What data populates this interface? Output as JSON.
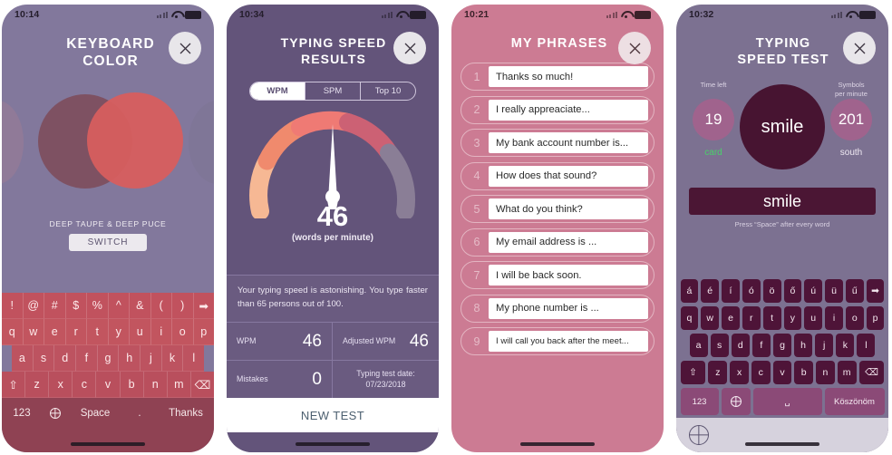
{
  "phones": [
    {
      "status": {
        "time": "10:14",
        "wifi_icon": "wifi-icon",
        "battery_icon": "battery-icon"
      },
      "title": "KEYBOARD\nCOLOR",
      "close_label": "close-icon",
      "palette_name": "DEEP TAUPE & DEEP PUCE",
      "switch_label": "SWITCH",
      "colors": {
        "swatch_a": "#7e4e5d",
        "swatch_b": "#d85e5e",
        "background": "#82789c",
        "keyboard": "#c2525f"
      },
      "keyboard": {
        "row1": [
          "!",
          "@",
          "#",
          "$",
          "%",
          "^",
          "&",
          "(",
          ")",
          "➡"
        ],
        "row2": [
          "q",
          "w",
          "e",
          "r",
          "t",
          "y",
          "u",
          "i",
          "o",
          "p"
        ],
        "row3": [
          "a",
          "s",
          "d",
          "f",
          "g",
          "h",
          "j",
          "k",
          "l"
        ],
        "row4": [
          "⇧",
          "z",
          "x",
          "c",
          "v",
          "b",
          "n",
          "m",
          "⌫"
        ],
        "bottom": {
          "numeric": "123",
          "globe": "globe-icon",
          "space": "Space",
          "period": ".",
          "suggestion": "Thanks"
        }
      }
    },
    {
      "status": {
        "time": "10:34",
        "wifi_icon": "wifi-icon",
        "battery_icon": "battery-icon"
      },
      "title": "TYPING SPEED\nRESULTS",
      "close_label": "close-icon",
      "segments": [
        {
          "label": "WPM",
          "active": true
        },
        {
          "label": "SPM",
          "active": false
        },
        {
          "label": "Top 10",
          "active": false
        }
      ],
      "gauge_value": "46",
      "gauge_unit": "(words per minute)",
      "message": "Your typing speed is astonishing. You type faster than 65 persons out of 100.",
      "stats": [
        {
          "label": "WPM",
          "value": "46"
        },
        {
          "label": "Adjusted WPM",
          "value": "46"
        },
        {
          "label": "Mistakes",
          "value": "0"
        },
        {
          "label": "Typing test date:\n07/23/2018",
          "value": ""
        }
      ],
      "new_test_label": "NEW TEST"
    },
    {
      "status": {
        "time": "10:21",
        "wifi_icon": "wifi-icon",
        "battery_icon": "battery-icon"
      },
      "title": "MY PHRASES",
      "close_label": "close-icon",
      "phrases": [
        {
          "num": "1",
          "text": "Thanks so much!"
        },
        {
          "num": "2",
          "text": "I really appreaciate..."
        },
        {
          "num": "3",
          "text": "My bank account number is..."
        },
        {
          "num": "4",
          "text": "How does that sound?"
        },
        {
          "num": "5",
          "text": "What do you think?"
        },
        {
          "num": "6",
          "text": "My email address is ..."
        },
        {
          "num": "7",
          "text": "I will be back soon."
        },
        {
          "num": "8",
          "text": "My phone number is ..."
        },
        {
          "num": "9",
          "text": "I will call you back after the meet..."
        }
      ]
    },
    {
      "status": {
        "time": "10:32",
        "wifi_icon": "wifi-icon",
        "battery_icon": "battery-icon"
      },
      "title": "TYPING\nSPEED TEST",
      "close_label": "close-icon",
      "time_left_caption": "Time left",
      "time_left_value": "19",
      "prev_word": "card",
      "prev_word_color": "#49d16a",
      "spm_caption": "Symbols\nper minute",
      "spm_value": "201",
      "next_word": "south",
      "current_word": "smile",
      "typed_word": "smile",
      "hint": "Press “Space” after every word",
      "keyboard": {
        "row1": [
          "á",
          "é",
          "í",
          "ó",
          "ö",
          "ő",
          "ú",
          "ü",
          "ű",
          "➡"
        ],
        "row2": [
          "q",
          "w",
          "e",
          "r",
          "t",
          "y",
          "u",
          "i",
          "o",
          "p"
        ],
        "row3": [
          "a",
          "s",
          "d",
          "f",
          "g",
          "h",
          "j",
          "k",
          "l"
        ],
        "row4": [
          "⇧",
          "z",
          "x",
          "c",
          "v",
          "b",
          "n",
          "m",
          "⌫"
        ],
        "bottom": {
          "numeric": "123",
          "globe": "globe-icon",
          "space": "␣",
          "suggestion": "Köszönöm"
        }
      }
    }
  ]
}
